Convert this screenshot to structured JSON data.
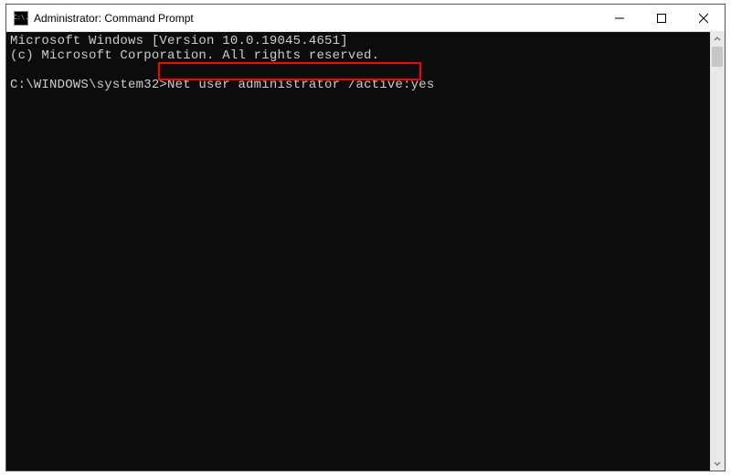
{
  "window": {
    "title": "Administrator: Command Prompt",
    "icon_text": "C:\\."
  },
  "console": {
    "line1": "Microsoft Windows [Version 10.0.19045.4651]",
    "line2": "(c) Microsoft Corporation. All rights reserved.",
    "blank1": "",
    "prompt": "C:\\WINDOWS\\system32>",
    "command": "Net user administrator /active:yes"
  }
}
